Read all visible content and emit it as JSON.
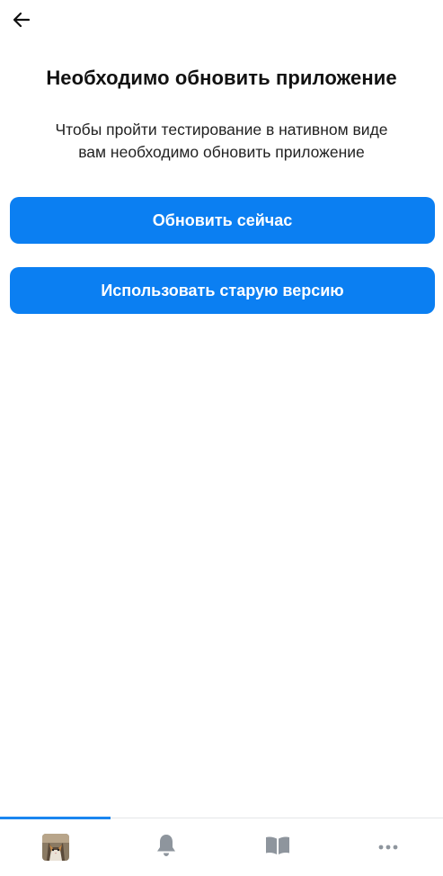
{
  "header": {
    "back_icon": "arrow-left-icon"
  },
  "dialog": {
    "title": "Необходимо обновить приложение",
    "description_line1": "Чтобы пройти тестирование в нативном виде",
    "description_line2": "вам необходимо обновить приложение"
  },
  "buttons": {
    "update_now": "Обновить сейчас",
    "use_old_version": "Использовать старую версию"
  },
  "tabbar": {
    "items": [
      {
        "icon": "profile-avatar"
      },
      {
        "icon": "bell-icon"
      },
      {
        "icon": "book-icon"
      },
      {
        "icon": "more-icon"
      }
    ],
    "active_index": 0
  },
  "colors": {
    "accent": "#0b7ff2",
    "icon_gray": "#8e959d",
    "text": "#111111"
  }
}
